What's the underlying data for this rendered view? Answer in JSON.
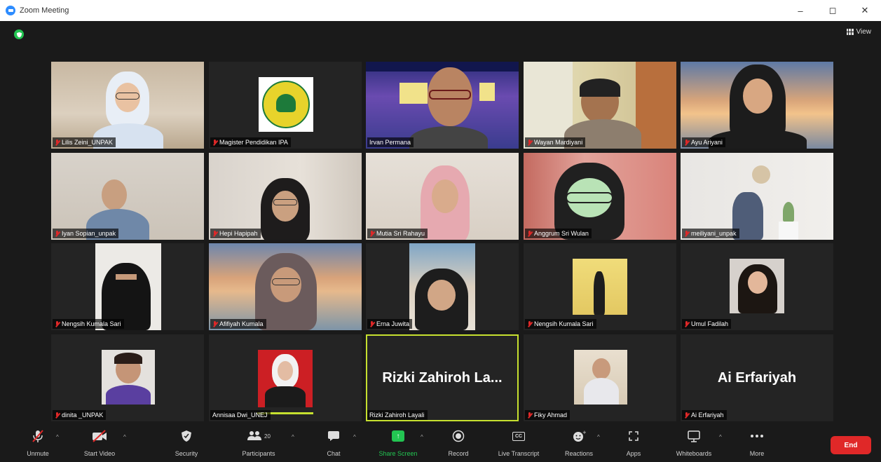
{
  "window": {
    "title": "Zoom Meeting",
    "minimize": "–",
    "maximize": "◻",
    "close": "✕"
  },
  "header": {
    "view_label": "View"
  },
  "participants": [
    {
      "name": "Lilis Zeini_UNPAK",
      "muted": true
    },
    {
      "name": "Magister Pendidikan IPA",
      "muted": true
    },
    {
      "name": "Irvan Permana",
      "muted": false
    },
    {
      "name": "Wayan Mardiyani",
      "muted": true
    },
    {
      "name": "Ayu Ariyani",
      "muted": true
    },
    {
      "name": "Iyan Sopian_unpak",
      "muted": true
    },
    {
      "name": "Hepi Hapipah",
      "muted": true
    },
    {
      "name": "Mutia Sri Rahayu",
      "muted": true
    },
    {
      "name": "Anggrum Sri Wulan",
      "muted": true
    },
    {
      "name": "meiliyani_unpak",
      "muted": true
    },
    {
      "name": "Nengsih Kumala Sari",
      "muted": true
    },
    {
      "name": "Afifiyah Kumala",
      "muted": true
    },
    {
      "name": "Erna Juwita",
      "muted": true
    },
    {
      "name": "Nengsih Kumala Sari",
      "muted": true
    },
    {
      "name": "Umul Fadilah",
      "muted": true
    },
    {
      "name": "dinita _UNPAK",
      "muted": true
    },
    {
      "name": "Annisaa Dwi_UNEJ",
      "muted": false
    },
    {
      "name": "Rizki Zahiroh Layali",
      "muted": false,
      "big_name": "Rizki Zahiroh La...",
      "active": true
    },
    {
      "name": "Fiky Ahmad",
      "muted": true
    },
    {
      "name": "Ai Erfariyah",
      "muted": true,
      "big_name": "Ai Erfariyah"
    }
  ],
  "toolbar": {
    "unmute": "Unmute",
    "start_video": "Start Video",
    "security": "Security",
    "participants": "Participants",
    "participants_count": "20",
    "chat": "Chat",
    "share_screen": "Share Screen",
    "record": "Record",
    "live_transcript": "Live Transcript",
    "reactions": "Reactions",
    "apps": "Apps",
    "whiteboards": "Whiteboards",
    "more": "More",
    "end": "End"
  },
  "colors": {
    "accent_green": "#23c552",
    "end_red": "#e02828",
    "active_outline": "#c6e02f"
  }
}
